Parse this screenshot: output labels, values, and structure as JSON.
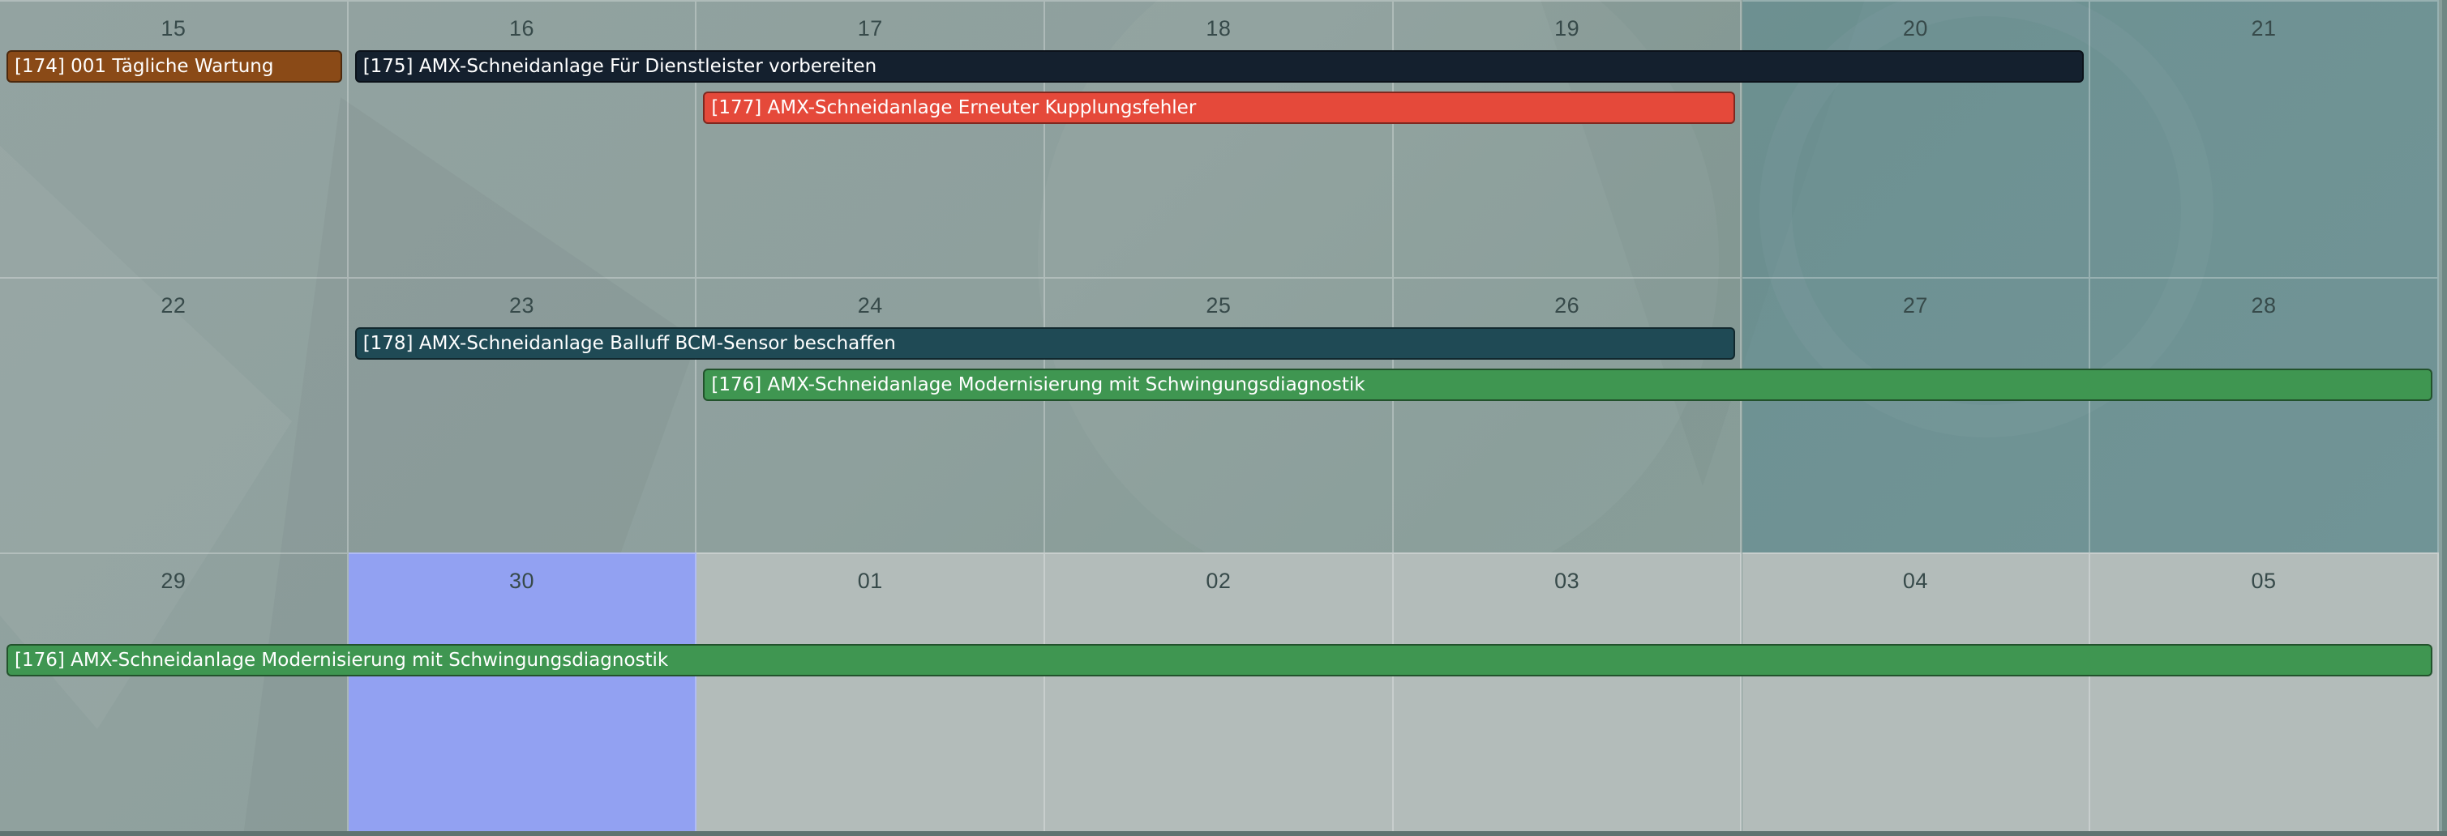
{
  "calendar": {
    "weeks": [
      {
        "days": [
          {
            "label": "15",
            "weekend": false
          },
          {
            "label": "16",
            "weekend": false
          },
          {
            "label": "17",
            "weekend": false
          },
          {
            "label": "18",
            "weekend": false
          },
          {
            "label": "19",
            "weekend": false
          },
          {
            "label": "20",
            "weekend": true
          },
          {
            "label": "21",
            "weekend": true
          }
        ],
        "events": [
          {
            "title": "[174] 001 Tägliche Wartung",
            "start": 0,
            "span": 1,
            "lane": 0,
            "color": "#8a4a17"
          },
          {
            "title": "[175] AMX-Schneidanlage Für Dienstleister vorbereiten",
            "start": 1,
            "span": 5,
            "lane": 0,
            "color": "#14202e"
          },
          {
            "title": "[177] AMX-Schneidanlage Erneuter Kupplungsfehler",
            "start": 2,
            "span": 3,
            "lane": 1,
            "color": "#e5493a"
          }
        ]
      },
      {
        "days": [
          {
            "label": "22",
            "weekend": false
          },
          {
            "label": "23",
            "weekend": false
          },
          {
            "label": "24",
            "weekend": false
          },
          {
            "label": "25",
            "weekend": false
          },
          {
            "label": "26",
            "weekend": false
          },
          {
            "label": "27",
            "weekend": true
          },
          {
            "label": "28",
            "weekend": true
          }
        ],
        "events": [
          {
            "title": "[178] AMX-Schneidanlage Balluff BCM-Sensor beschaffen",
            "start": 1,
            "span": 4,
            "lane": 0,
            "color": "#1f4a55"
          },
          {
            "title": "[176] AMX-Schneidanlage Modernisierung mit Schwingungsdiagnostik",
            "start": 2,
            "span": 5,
            "lane": 1,
            "color": "#3f9651"
          }
        ]
      },
      {
        "days": [
          {
            "label": "29",
            "weekend": false
          },
          {
            "label": "30",
            "weekend": false,
            "today": true
          },
          {
            "label": "01",
            "weekend": false,
            "nextMonth": true
          },
          {
            "label": "02",
            "weekend": false,
            "nextMonth": true
          },
          {
            "label": "03",
            "weekend": false,
            "nextMonth": true
          },
          {
            "label": "04",
            "weekend": true,
            "nextMonth": true
          },
          {
            "label": "05",
            "weekend": true,
            "nextMonth": true
          }
        ],
        "events": [
          {
            "title": "[176] AMX-Schneidanlage Modernisierung mit Schwingungsdiagnostik",
            "start": 0,
            "span": 7,
            "lane": 1,
            "color": "#3f9651"
          }
        ]
      }
    ]
  }
}
